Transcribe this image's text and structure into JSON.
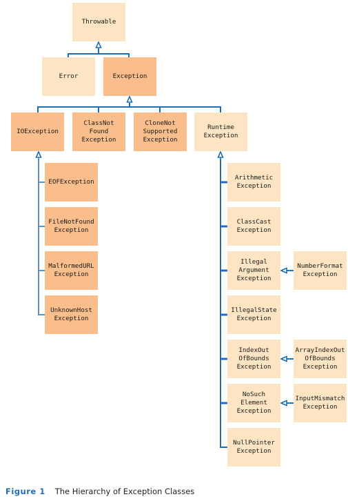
{
  "colors": {
    "connector": "#1f6eb5",
    "connector_light": "#5b8fc9",
    "checked_exception_fill": "#f9be8b",
    "other_fill": "#fde4c3",
    "caption_label": "#1f6eb5"
  },
  "nodes": {
    "throwable": "Throwable",
    "error": "Error",
    "exception": "Exception",
    "io_exception": "IOException",
    "class_not_found": "ClassNot\nFound\nException",
    "clone_not_supported": "CloneNot\nSupported\nException",
    "runtime_exception": "Runtime\nException",
    "eof_exception": "EOFException",
    "file_not_found": "FileNotFound\nException",
    "malformed_url": "MalformedURL\nException",
    "unknown_host": "UnknownHost\nException",
    "arithmetic": "Arithmetic\nException",
    "class_cast": "ClassCast\nException",
    "illegal_argument": "Illegal\nArgument\nException",
    "number_format": "NumberFormat\nException",
    "illegal_state": "IllegalState\nException",
    "index_out_of_bounds": "IndexOut\nOfBounds\nException",
    "array_index_out_of_bounds": "ArrayIndexOut\nOfBounds\nException",
    "no_such_element": "NoSuch\nElement\nException",
    "input_mismatch": "InputMismatch\nException",
    "null_pointer": "NullPointer\nException"
  },
  "edges": [
    [
      "error",
      "throwable"
    ],
    [
      "exception",
      "throwable"
    ],
    [
      "io_exception",
      "exception"
    ],
    [
      "class_not_found",
      "exception"
    ],
    [
      "clone_not_supported",
      "exception"
    ],
    [
      "runtime_exception",
      "exception"
    ],
    [
      "eof_exception",
      "io_exception"
    ],
    [
      "file_not_found",
      "io_exception"
    ],
    [
      "malformed_url",
      "io_exception"
    ],
    [
      "unknown_host",
      "io_exception"
    ],
    [
      "arithmetic",
      "runtime_exception"
    ],
    [
      "class_cast",
      "runtime_exception"
    ],
    [
      "illegal_argument",
      "runtime_exception"
    ],
    [
      "illegal_state",
      "runtime_exception"
    ],
    [
      "index_out_of_bounds",
      "runtime_exception"
    ],
    [
      "no_such_element",
      "runtime_exception"
    ],
    [
      "null_pointer",
      "runtime_exception"
    ],
    [
      "number_format",
      "illegal_argument"
    ],
    [
      "array_index_out_of_bounds",
      "index_out_of_bounds"
    ],
    [
      "input_mismatch",
      "no_such_element"
    ]
  ],
  "caption": {
    "label": "Figure 1",
    "text": "The Hierarchy of Exception Classes"
  }
}
